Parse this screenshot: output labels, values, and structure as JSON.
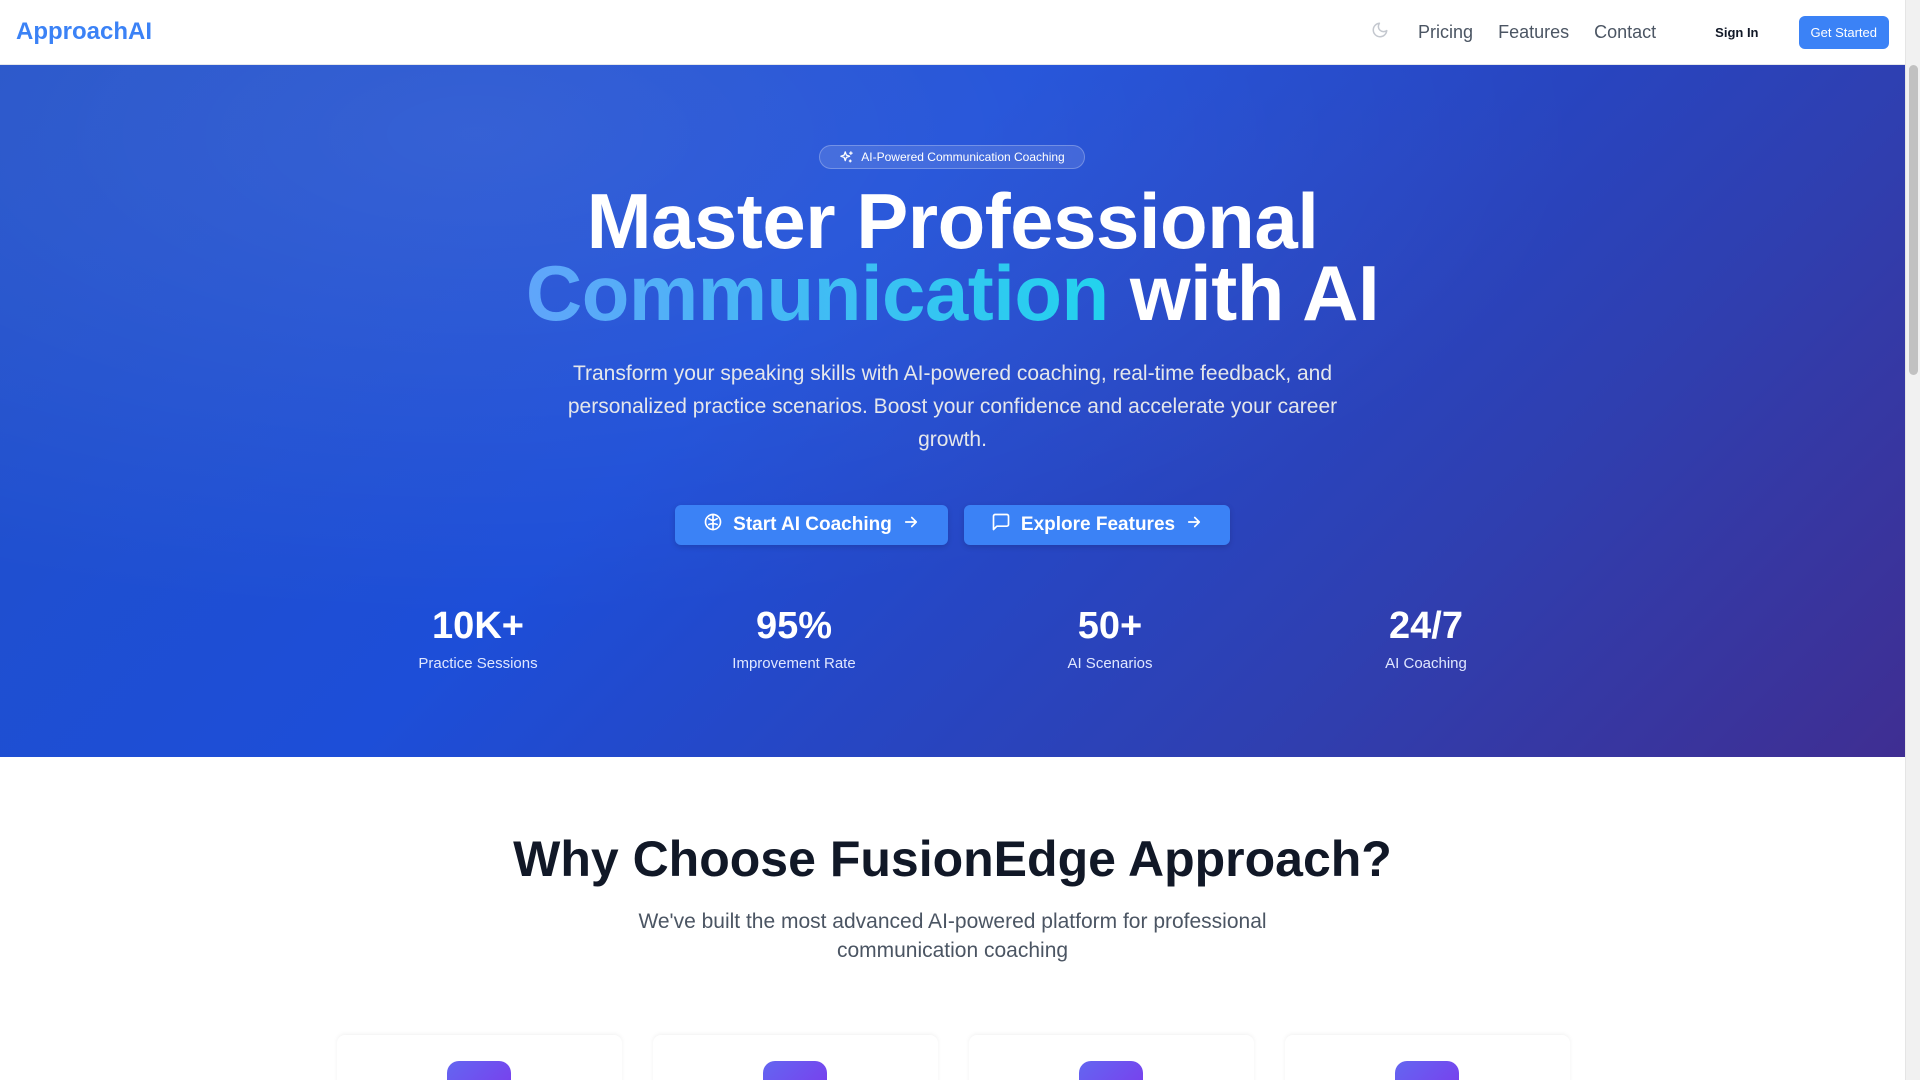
{
  "header": {
    "logo": "ApproachAI",
    "nav": [
      "Pricing",
      "Features",
      "Contact"
    ],
    "sign_in": "Sign In",
    "get_started": "Get Started",
    "theme_icon": "moon-icon"
  },
  "hero": {
    "badge": "AI-Powered Communication Coaching",
    "badge_icon": "sparkles-icon",
    "title_line1": "Master Professional",
    "title_highlight": "Communication",
    "title_rest": "with AI",
    "subtitle": "Transform your speaking skills with AI-powered coaching, real-time feedback, and personalized practice scenarios. Boost your confidence and accelerate your career growth.",
    "buttons": [
      {
        "label": "Start AI Coaching",
        "icon": "brain-icon"
      },
      {
        "label": "Explore Features",
        "icon": "message-icon"
      }
    ],
    "stats": [
      {
        "value": "10K+",
        "label": "Practice Sessions"
      },
      {
        "value": "95%",
        "label": "Improvement Rate"
      },
      {
        "value": "50+",
        "label": "AI Scenarios"
      },
      {
        "value": "24/7",
        "label": "AI Coaching"
      }
    ]
  },
  "why": {
    "title": "Why Choose FusionEdge Approach?",
    "subtitle": "We've built the most advanced AI-powered platform for professional communication coaching"
  },
  "colors": {
    "accent": "#3b82f6",
    "hero_start": "#2150c8",
    "hero_end": "#3f2e92",
    "highlight_start": "#60a5fa",
    "highlight_end": "#22d3ee"
  }
}
